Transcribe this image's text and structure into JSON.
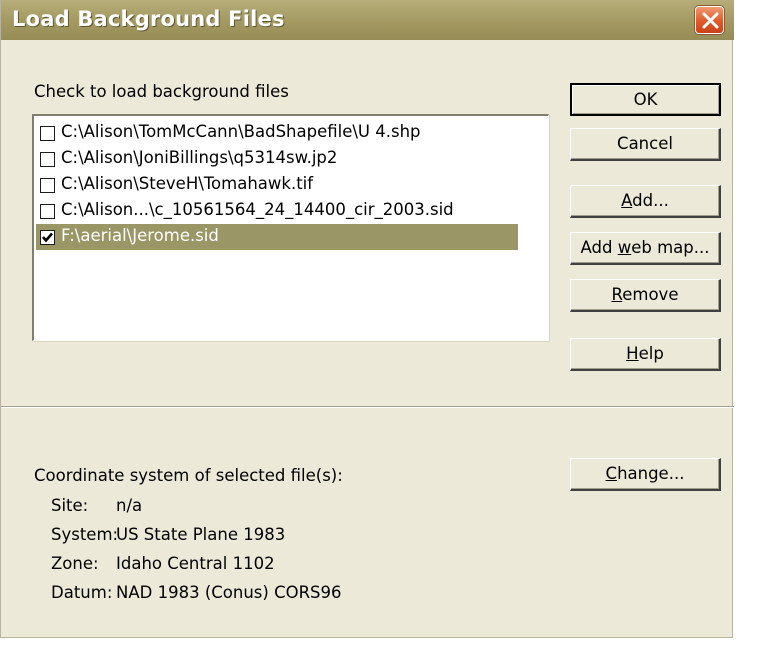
{
  "window": {
    "title": "Load Background Files"
  },
  "instructions": "Check to load background files",
  "files": [
    {
      "path": "C:\\Alison\\TomMcCann\\BadShapefile\\U 4.shp",
      "checked": false,
      "selected": false
    },
    {
      "path": "C:\\Alison\\JoniBillings\\q5314sw.jp2",
      "checked": false,
      "selected": false
    },
    {
      "path": "C:\\Alison\\SteveH\\Tomahawk.tif",
      "checked": false,
      "selected": false
    },
    {
      "path": "C:\\Alison...\\c_10561564_24_14400_cir_2003.sid",
      "checked": false,
      "selected": false
    },
    {
      "path": "F:\\aerial\\Jerome.sid",
      "checked": true,
      "selected": true
    }
  ],
  "buttons": {
    "ok": "OK",
    "cancel": "Cancel",
    "add": "Add...",
    "add_web_map": "Add web map...",
    "remove": "Remove",
    "help": "Help",
    "change": "Change..."
  },
  "coordinate_system": {
    "heading": "Coordinate system of selected file(s):",
    "site_label": "Site:",
    "site_value": "n/a",
    "system_label": "System:",
    "system_value": "US State Plane 1983",
    "zone_label": "Zone:",
    "zone_value": "Idaho Central 1102",
    "datum_label": "Datum:",
    "datum_value": "NAD 1983 (Conus) CORS96"
  },
  "colors": {
    "titlebar": "#a49a62",
    "dialog_bg": "#ece9d8",
    "selection": "#9a9665",
    "close_button": "#de5a2a"
  }
}
